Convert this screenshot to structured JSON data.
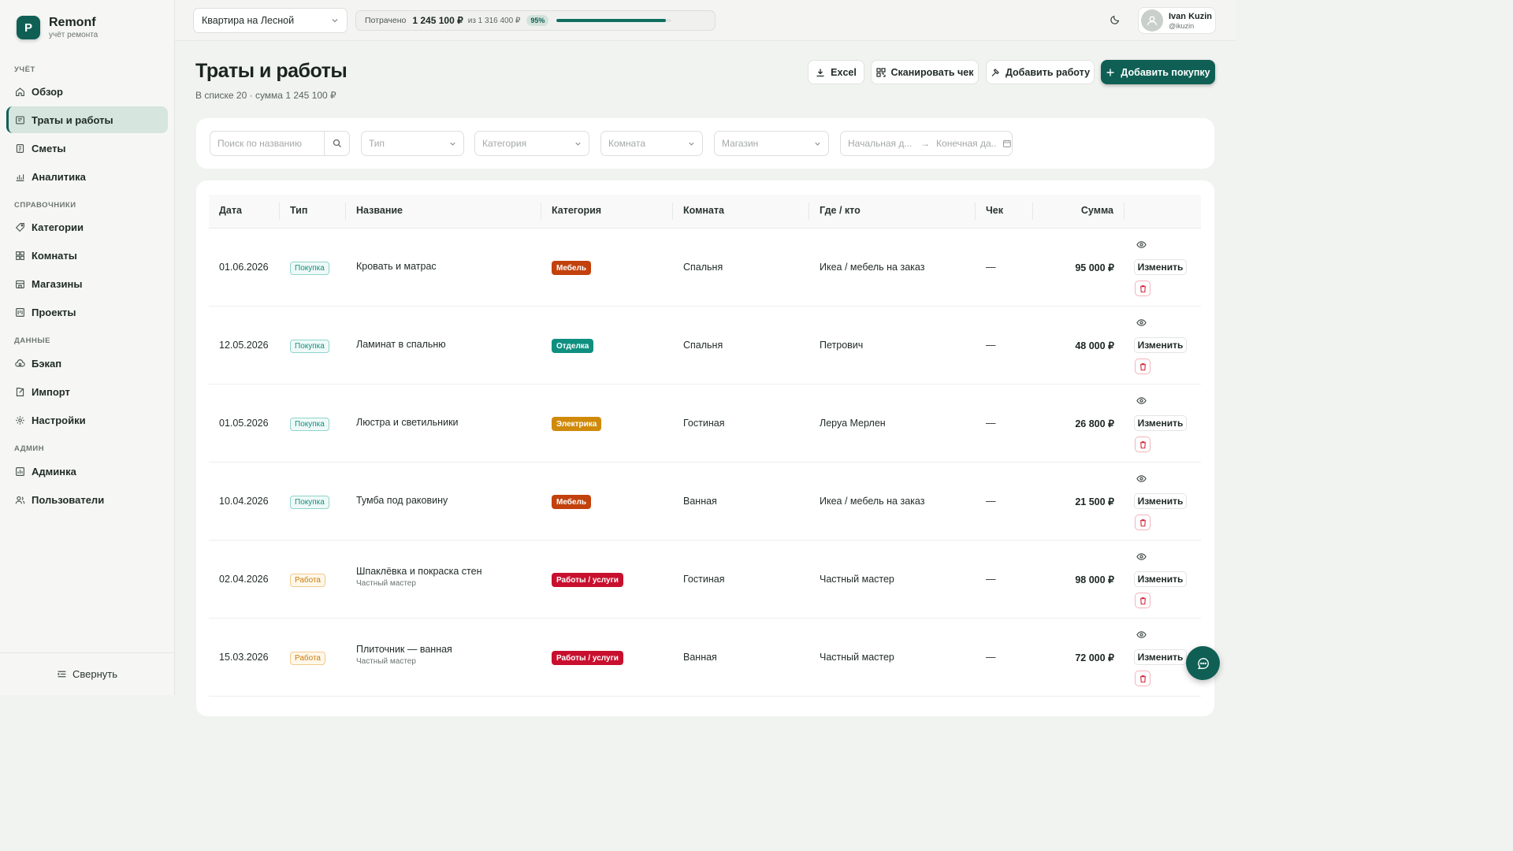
{
  "brand": {
    "name": "Remonf",
    "subtitle": "учёт ремонта",
    "logo_letter": "P"
  },
  "sidebar": {
    "sections": [
      "УЧЁТ",
      "СПРАВОЧНИКИ",
      "ДАННЫЕ",
      "АДМИН"
    ],
    "items": [
      {
        "label": "Обзор",
        "icon": "home-icon"
      },
      {
        "label": "Траты и работы",
        "icon": "receipt-icon",
        "active": true
      },
      {
        "label": "Сметы",
        "icon": "estimate-icon"
      },
      {
        "label": "Аналитика",
        "icon": "chart-icon"
      },
      {
        "label": "Категории",
        "icon": "tag-icon"
      },
      {
        "label": "Комнаты",
        "icon": "grid-icon"
      },
      {
        "label": "Магазины",
        "icon": "store-icon"
      },
      {
        "label": "Проекты",
        "icon": "project-icon"
      },
      {
        "label": "Бэкап",
        "icon": "backup-icon"
      },
      {
        "label": "Импорт",
        "icon": "import-icon"
      },
      {
        "label": "Настройки",
        "icon": "gear-icon"
      },
      {
        "label": "Админка",
        "icon": "admin-icon"
      },
      {
        "label": "Пользователи",
        "icon": "users-icon"
      }
    ],
    "collapse_label": "Свернуть"
  },
  "topbar": {
    "project": "Квартира на Лесной",
    "budget": {
      "label": "Потрачено",
      "spent": "1 245 100 ₽",
      "of": "из 1 316 400 ₽",
      "percent_label": "95%",
      "progress": 0.95
    },
    "user": {
      "name": "Ivan Kuzin",
      "handle": "@ikuzin"
    }
  },
  "page": {
    "title": "Траты и работы",
    "subtitle": "В списке 20 · сумма 1 245 100 ₽",
    "buttons": {
      "excel": "Excel",
      "scan": "Сканировать чек",
      "add_work": "Добавить работу",
      "add_purchase": "Добавить покупку"
    }
  },
  "filters": {
    "search_placeholder": "Поиск по названию",
    "type": "Тип",
    "category": "Категория",
    "room": "Комната",
    "store": "Магазин",
    "date_start": "Начальная д...",
    "date_end": "Конечная да..."
  },
  "table": {
    "headers": [
      "Дата",
      "Тип",
      "Название",
      "Категория",
      "Комната",
      "Где / кто",
      "Чек",
      "Сумма"
    ],
    "edit_label": "Изменить",
    "rows": [
      {
        "date": "01.06.2026",
        "type": "Покупка",
        "kind": "purchase",
        "name": "Кровать и матрас",
        "sub": "",
        "category": "Мебель",
        "cat_color": "#c2410c",
        "room": "Спальня",
        "where": "Икеа / мебель на заказ",
        "receipt": "—",
        "amount": "95 000 ₽"
      },
      {
        "date": "12.05.2026",
        "type": "Покупка",
        "kind": "purchase",
        "name": "Ламинат в спальню",
        "sub": "",
        "category": "Отделка",
        "cat_color": "#0f8f80",
        "room": "Спальня",
        "where": "Петрович",
        "receipt": "—",
        "amount": "48 000 ₽"
      },
      {
        "date": "01.05.2026",
        "type": "Покупка",
        "kind": "purchase",
        "name": "Люстра и светильники",
        "sub": "",
        "category": "Электрика",
        "cat_color": "#d08a0a",
        "room": "Гостиная",
        "where": "Леруа Мерлен",
        "receipt": "—",
        "amount": "26 800 ₽"
      },
      {
        "date": "10.04.2026",
        "type": "Покупка",
        "kind": "purchase",
        "name": "Тумба под раковину",
        "sub": "",
        "category": "Мебель",
        "cat_color": "#c2410c",
        "room": "Ванная",
        "where": "Икеа / мебель на заказ",
        "receipt": "—",
        "amount": "21 500 ₽"
      },
      {
        "date": "02.04.2026",
        "type": "Работа",
        "kind": "work",
        "name": "Шпаклёвка и покраска стен",
        "sub": "Частный мастер",
        "category": "Работы / услуги",
        "cat_color": "#c8102e",
        "room": "Гостиная",
        "where": "Частный мастер",
        "receipt": "—",
        "amount": "98 000 ₽"
      },
      {
        "date": "15.03.2026",
        "type": "Работа",
        "kind": "work",
        "name": "Плиточник — ванная",
        "sub": "Частный мастер",
        "category": "Работы / услуги",
        "cat_color": "#c8102e",
        "room": "Ванная",
        "where": "Частный мастер",
        "receipt": "—",
        "amount": "72 000 ₽"
      }
    ]
  },
  "icons": {
    "search": "search-icon",
    "calendar": "calendar-icon",
    "eye": "eye-icon",
    "trash": "trash-icon",
    "chat": "chat-icon",
    "theme": "moon-icon"
  }
}
